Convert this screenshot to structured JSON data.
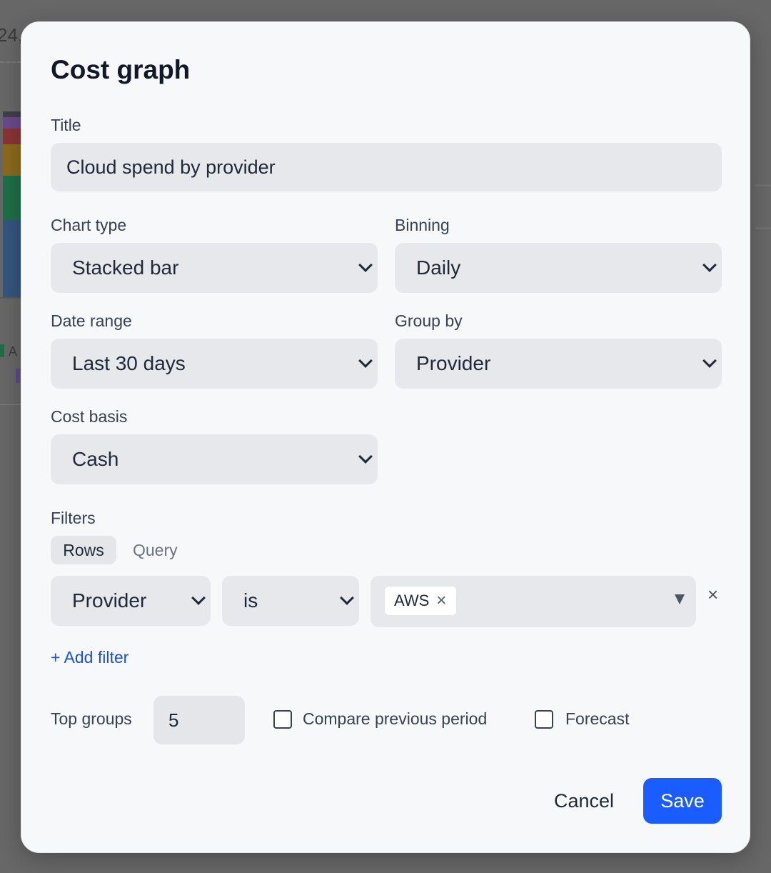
{
  "background": {
    "top_text": "24,",
    "legend_text": "A",
    "bar_colors": [
      "#3f3f4a",
      "#8b5fbf",
      "#c0392b",
      "#c08a1a",
      "#1a9a5a",
      "#3a6aa8"
    ]
  },
  "modal": {
    "title": "Cost graph",
    "title_field": {
      "label": "Title",
      "value": "Cloud spend by provider"
    },
    "chart_type": {
      "label": "Chart type",
      "value": "Stacked bar"
    },
    "binning": {
      "label": "Binning",
      "value": "Daily"
    },
    "date_range": {
      "label": "Date range",
      "value": "Last 30 days"
    },
    "group_by": {
      "label": "Group by",
      "value": "Provider"
    },
    "cost_basis": {
      "label": "Cost basis",
      "value": "Cash"
    },
    "filters": {
      "label": "Filters",
      "tabs": [
        "Rows",
        "Query"
      ],
      "active_tab": "Rows",
      "rows": [
        {
          "field": "Provider",
          "operator": "is",
          "values": [
            "AWS"
          ]
        }
      ],
      "remove_icon": "×",
      "chip_remove_icon": "×",
      "add_label": "+ Add filter"
    },
    "top_groups": {
      "label": "Top groups",
      "value": "5"
    },
    "compare_previous": {
      "label": "Compare previous period",
      "checked": false
    },
    "forecast": {
      "label": "Forecast",
      "checked": false
    },
    "actions": {
      "cancel": "Cancel",
      "save": "Save"
    },
    "colors": {
      "primary": "#1a5cff",
      "link": "#1d4ed8"
    }
  }
}
